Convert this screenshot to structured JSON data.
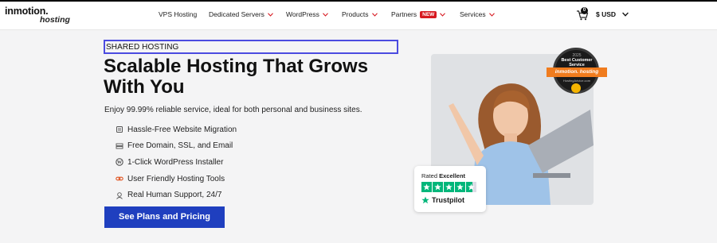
{
  "header": {
    "logo_brand": "inmotion.",
    "logo_sub": "hosting",
    "nav": [
      {
        "label": "VPS Hosting",
        "has_menu": false
      },
      {
        "label": "Dedicated Servers",
        "has_menu": true
      },
      {
        "label": "WordPress",
        "has_menu": true
      },
      {
        "label": "Products",
        "has_menu": true
      },
      {
        "label": "Partners",
        "badge": "NEW",
        "has_menu": true
      },
      {
        "label": "Services",
        "has_menu": true
      }
    ],
    "cart_count": "0",
    "currency": "$ USD"
  },
  "hero": {
    "kicker": "SHARED HOSTING",
    "headline_line1": "Scalable Hosting That Grows",
    "headline_line2": "With You",
    "lead": "Enjoy 99.99% reliable service, ideal for both personal and business sites.",
    "features": [
      {
        "icon": "migration-icon",
        "label": "Hassle-Free Website Migration"
      },
      {
        "icon": "server-icon",
        "label": "Free Domain, SSL, and Email"
      },
      {
        "icon": "wordpress-icon",
        "label": "1-Click WordPress Installer"
      },
      {
        "icon": "link-icon",
        "label": "User Friendly Hosting Tools"
      },
      {
        "icon": "support-icon",
        "label": "Real Human Support, 24/7"
      }
    ],
    "cta": "See Plans and Pricing"
  },
  "award": {
    "year": "2025",
    "title_line1": "Best Customer",
    "title_line2": "Service",
    "ribbon": "inmotion. hosting",
    "source": "HostingAdvice.com"
  },
  "trustpilot": {
    "rated_prefix": "Rated",
    "rating_word": "Excellent",
    "brand": "Trustpilot",
    "stars": 4.5
  },
  "colors": {
    "accent": "#1f3fbf",
    "badge_new": "#d71920",
    "chevron": "#d71920",
    "trustpilot_green": "#00b67a",
    "award_orange": "#f07c1e"
  }
}
